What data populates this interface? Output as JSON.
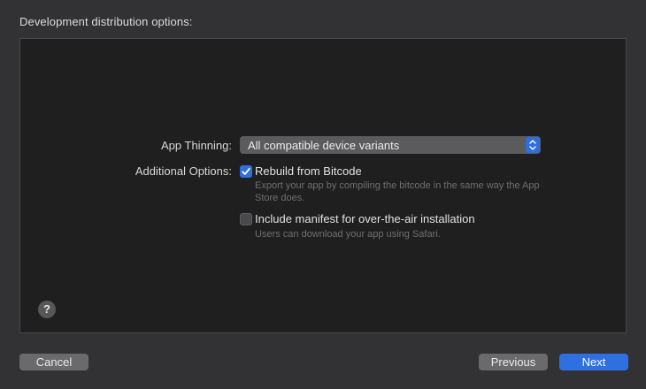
{
  "heading": "Development distribution options:",
  "app_thinning": {
    "label": "App Thinning:",
    "selected": "All compatible device variants"
  },
  "additional_options": {
    "label": "Additional Options:",
    "options": [
      {
        "label": "Rebuild from Bitcode",
        "checked": true,
        "description": "Export your app by compiling the bitcode in the same way the App Store does."
      },
      {
        "label": "Include manifest for over-the-air installation",
        "checked": false,
        "description": "Users can download your app using Safari."
      }
    ]
  },
  "help_glyph": "?",
  "buttons": {
    "cancel": "Cancel",
    "previous": "Previous",
    "next": "Next"
  },
  "colors": {
    "accent": "#2f6fe0",
    "panel_background": "#1f1f1f",
    "window_background": "#323133"
  },
  "icons": {
    "popup_stepper": "chevron-up-down-icon",
    "checkmark": "checkmark-icon",
    "help": "question-mark-icon"
  }
}
